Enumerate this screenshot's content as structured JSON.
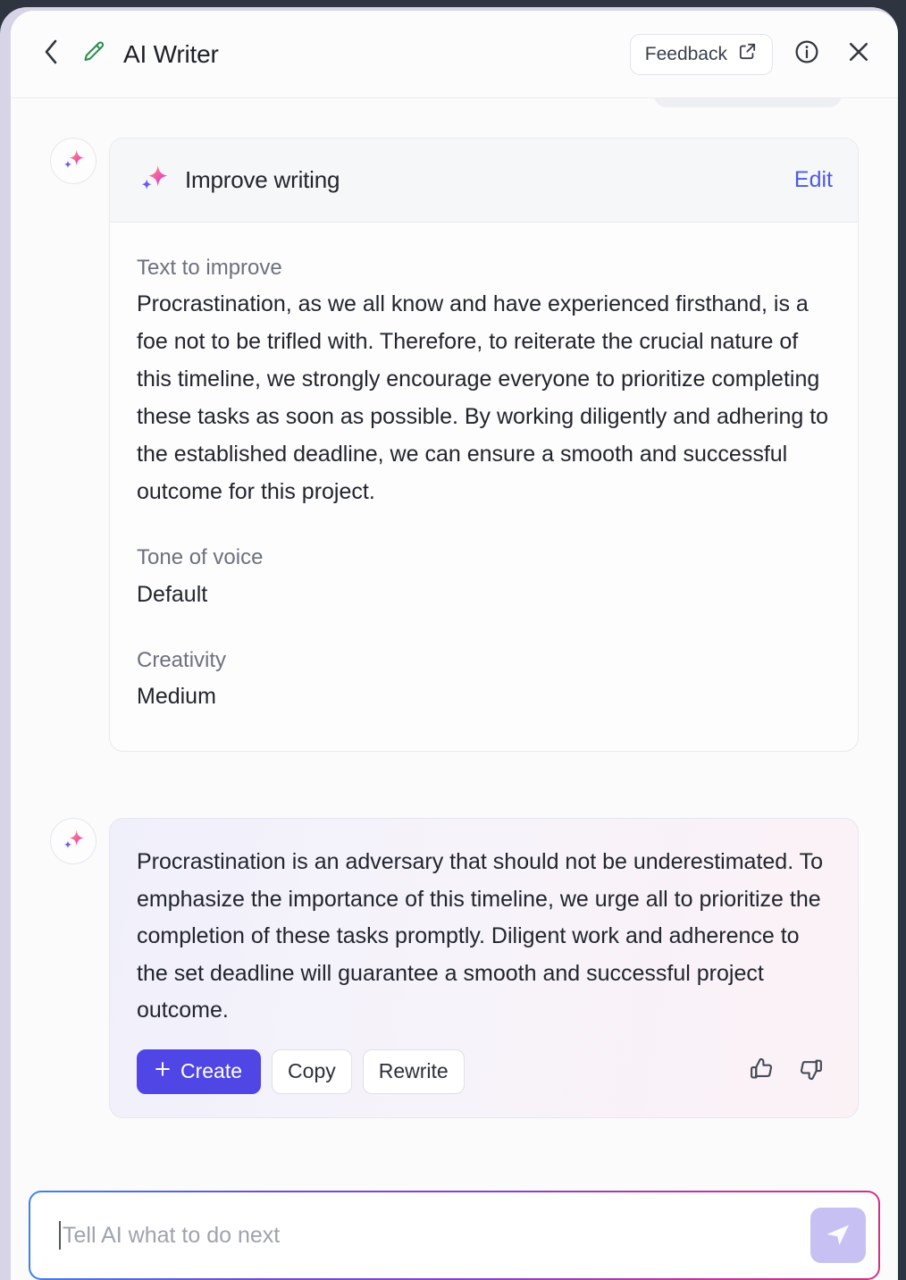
{
  "header": {
    "back_icon": "chevron-left-icon",
    "edit_icon": "pencil-icon",
    "title": "AI Writer",
    "feedback_label": "Feedback",
    "feedback_icon": "external-link-icon",
    "info_icon": "info-circle-icon",
    "close_icon": "close-icon"
  },
  "prompt_card": {
    "avatar_icon": "ai-sparkle-icon",
    "title_icon": "ai-sparkle-icon",
    "title": "Improve writing",
    "edit_label": "Edit",
    "fields": [
      {
        "label": "Text to improve",
        "value": "Procrastination, as we all know and have experienced firsthand, is a foe not to be trifled with. Therefore, to reiterate the crucial nature of this timeline, we strongly encourage everyone to prioritize completing these tasks as soon as possible. By working diligently and adhering to the established deadline, we can ensure a smooth and successful outcome for this project."
      },
      {
        "label": "Tone of voice",
        "value": "Default"
      },
      {
        "label": "Creativity",
        "value": "Medium"
      }
    ]
  },
  "response": {
    "avatar_icon": "ai-sparkle-icon",
    "text": "Procrastination is an adversary that should not be underestimated. To emphasize the importance of this timeline, we urge all to prioritize the completion of these tasks promptly. Diligent work and adherence to the set deadline will guarantee a smooth and successful project outcome.",
    "actions": {
      "create_label": "Create",
      "create_icon": "plus-icon",
      "copy_label": "Copy",
      "rewrite_label": "Rewrite",
      "thumbs_up_icon": "thumbs-up-icon",
      "thumbs_down_icon": "thumbs-down-icon"
    }
  },
  "composer": {
    "placeholder": "Tell AI what to do next",
    "value": "",
    "send_icon": "send-icon"
  },
  "colors": {
    "accent": "#4f46e5",
    "link": "#4f5ae8",
    "pencil": "#2f8f51",
    "send_button_bg": "#c6c1f2"
  }
}
